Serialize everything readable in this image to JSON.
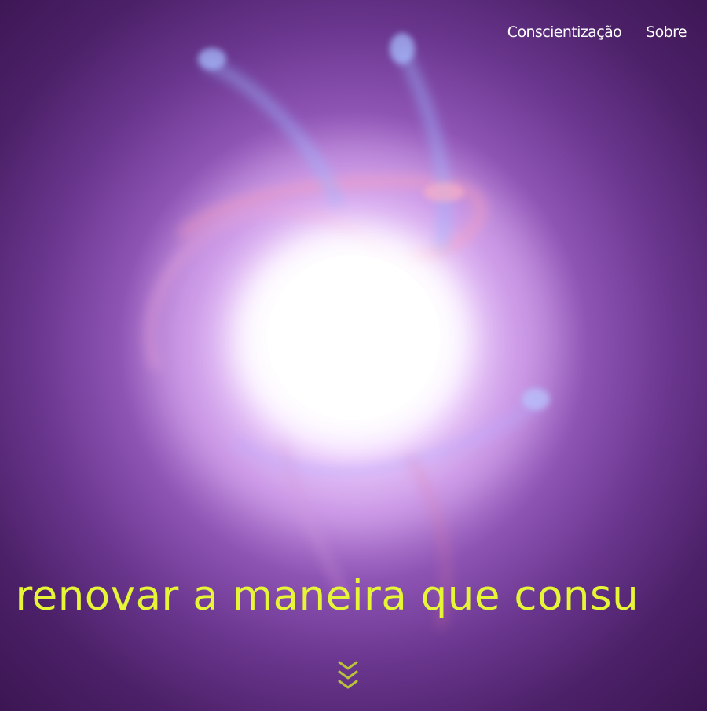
{
  "nav": {
    "items": [
      {
        "label": "Conscientização"
      },
      {
        "label": "Sobre"
      }
    ]
  },
  "hero": {
    "marquee_text": "s renovar a maneira que consu",
    "scroll_icon": "chevron-triple-down-icon"
  },
  "colors": {
    "accent": "#e6f535",
    "background_dark": "#35124a",
    "background_mid": "#8e54b4",
    "glow_center": "#ffffff",
    "nav_text": "#ffffff"
  }
}
